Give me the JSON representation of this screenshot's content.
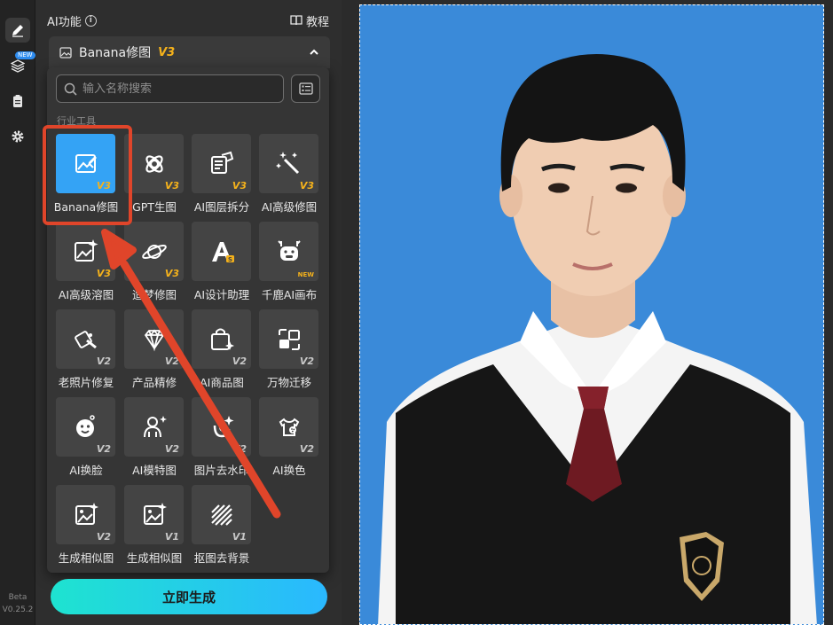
{
  "rail": {
    "items": [
      {
        "icon": "pen-icon",
        "active": true
      },
      {
        "icon": "layers-icon",
        "badge": "NEW"
      },
      {
        "icon": "clipboard-icon"
      },
      {
        "icon": "gear-icon"
      }
    ],
    "beta": "Beta",
    "version": "V0.25.2"
  },
  "panel": {
    "title": "AI功能",
    "tutorial": "教程",
    "section": {
      "name": "Banana修图",
      "version": "V3"
    }
  },
  "search": {
    "placeholder": "输入名称搜索"
  },
  "category": "行业工具",
  "tools": [
    {
      "name": "Banana修图",
      "ver": "V3",
      "icon": "image-edit-icon",
      "selected": true
    },
    {
      "name": "GPT生图",
      "ver": "V3",
      "icon": "gpt-knot-icon"
    },
    {
      "name": "AI图层拆分",
      "ver": "V3",
      "icon": "layers-split-icon"
    },
    {
      "name": "AI高级修图",
      "ver": "V3",
      "icon": "magic-wand-icon"
    },
    {
      "name": "AI高级溶图",
      "ver": "V3",
      "icon": "image-sparkle-icon"
    },
    {
      "name": "造梦修图",
      "ver": "V3",
      "icon": "planet-icon"
    },
    {
      "name": "AI设计助理",
      "ver": "",
      "icon": "design-a-icon"
    },
    {
      "name": "千鹿AI画布",
      "ver": "NEW",
      "icon": "deer-icon"
    },
    {
      "name": "老照片修复",
      "ver": "V2",
      "icon": "repair-icon"
    },
    {
      "name": "产品精修",
      "ver": "V2",
      "icon": "diamond-icon"
    },
    {
      "name": "AI商品图",
      "ver": "V2",
      "icon": "bag-icon"
    },
    {
      "name": "万物迁移",
      "ver": "V2",
      "icon": "transfer-icon"
    },
    {
      "name": "AI换脸",
      "ver": "V2",
      "icon": "face-icon"
    },
    {
      "name": "AI模特图",
      "ver": "V2",
      "icon": "model-icon"
    },
    {
      "name": "图片去水印",
      "ver": "V2",
      "icon": "watermark-icon"
    },
    {
      "name": "AI换色",
      "ver": "V2",
      "icon": "palette-icon"
    },
    {
      "name": "生成相似图",
      "ver": "V2",
      "icon": "similar-image-icon"
    },
    {
      "name": "生成相似图",
      "ver": "V1",
      "icon": "similar-image-icon"
    },
    {
      "name": "抠图去背景",
      "ver": "V1",
      "icon": "cutout-icon"
    }
  ],
  "generate_button": "立即生成",
  "colors": {
    "accent": "#34a3f5",
    "version_gold": "#f5b21b",
    "highlight": "#e0452a",
    "photo_bg": "#3a8ad9"
  }
}
